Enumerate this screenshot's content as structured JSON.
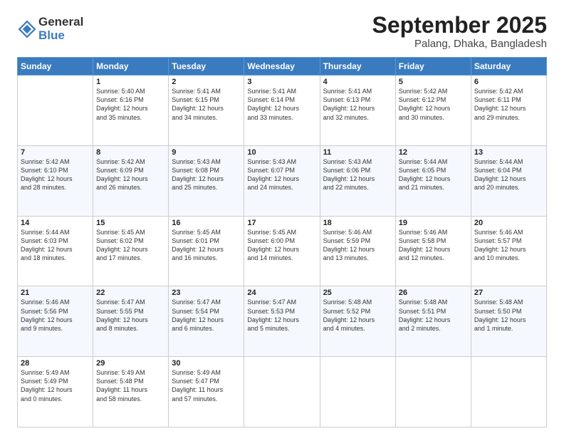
{
  "logo": {
    "general": "General",
    "blue": "Blue"
  },
  "title": {
    "month": "September 2025",
    "location": "Palang, Dhaka, Bangladesh"
  },
  "headers": [
    "Sunday",
    "Monday",
    "Tuesday",
    "Wednesday",
    "Thursday",
    "Friday",
    "Saturday"
  ],
  "weeks": [
    [
      {
        "day": "",
        "info": ""
      },
      {
        "day": "1",
        "info": "Sunrise: 5:40 AM\nSunset: 6:16 PM\nDaylight: 12 hours\nand 35 minutes."
      },
      {
        "day": "2",
        "info": "Sunrise: 5:41 AM\nSunset: 6:15 PM\nDaylight: 12 hours\nand 34 minutes."
      },
      {
        "day": "3",
        "info": "Sunrise: 5:41 AM\nSunset: 6:14 PM\nDaylight: 12 hours\nand 33 minutes."
      },
      {
        "day": "4",
        "info": "Sunrise: 5:41 AM\nSunset: 6:13 PM\nDaylight: 12 hours\nand 32 minutes."
      },
      {
        "day": "5",
        "info": "Sunrise: 5:42 AM\nSunset: 6:12 PM\nDaylight: 12 hours\nand 30 minutes."
      },
      {
        "day": "6",
        "info": "Sunrise: 5:42 AM\nSunset: 6:11 PM\nDaylight: 12 hours\nand 29 minutes."
      }
    ],
    [
      {
        "day": "7",
        "info": "Sunrise: 5:42 AM\nSunset: 6:10 PM\nDaylight: 12 hours\nand 28 minutes."
      },
      {
        "day": "8",
        "info": "Sunrise: 5:42 AM\nSunset: 6:09 PM\nDaylight: 12 hours\nand 26 minutes."
      },
      {
        "day": "9",
        "info": "Sunrise: 5:43 AM\nSunset: 6:08 PM\nDaylight: 12 hours\nand 25 minutes."
      },
      {
        "day": "10",
        "info": "Sunrise: 5:43 AM\nSunset: 6:07 PM\nDaylight: 12 hours\nand 24 minutes."
      },
      {
        "day": "11",
        "info": "Sunrise: 5:43 AM\nSunset: 6:06 PM\nDaylight: 12 hours\nand 22 minutes."
      },
      {
        "day": "12",
        "info": "Sunrise: 5:44 AM\nSunset: 6:05 PM\nDaylight: 12 hours\nand 21 minutes."
      },
      {
        "day": "13",
        "info": "Sunrise: 5:44 AM\nSunset: 6:04 PM\nDaylight: 12 hours\nand 20 minutes."
      }
    ],
    [
      {
        "day": "14",
        "info": "Sunrise: 5:44 AM\nSunset: 6:03 PM\nDaylight: 12 hours\nand 18 minutes."
      },
      {
        "day": "15",
        "info": "Sunrise: 5:45 AM\nSunset: 6:02 PM\nDaylight: 12 hours\nand 17 minutes."
      },
      {
        "day": "16",
        "info": "Sunrise: 5:45 AM\nSunset: 6:01 PM\nDaylight: 12 hours\nand 16 minutes."
      },
      {
        "day": "17",
        "info": "Sunrise: 5:45 AM\nSunset: 6:00 PM\nDaylight: 12 hours\nand 14 minutes."
      },
      {
        "day": "18",
        "info": "Sunrise: 5:46 AM\nSunset: 5:59 PM\nDaylight: 12 hours\nand 13 minutes."
      },
      {
        "day": "19",
        "info": "Sunrise: 5:46 AM\nSunset: 5:58 PM\nDaylight: 12 hours\nand 12 minutes."
      },
      {
        "day": "20",
        "info": "Sunrise: 5:46 AM\nSunset: 5:57 PM\nDaylight: 12 hours\nand 10 minutes."
      }
    ],
    [
      {
        "day": "21",
        "info": "Sunrise: 5:46 AM\nSunset: 5:56 PM\nDaylight: 12 hours\nand 9 minutes."
      },
      {
        "day": "22",
        "info": "Sunrise: 5:47 AM\nSunset: 5:55 PM\nDaylight: 12 hours\nand 8 minutes."
      },
      {
        "day": "23",
        "info": "Sunrise: 5:47 AM\nSunset: 5:54 PM\nDaylight: 12 hours\nand 6 minutes."
      },
      {
        "day": "24",
        "info": "Sunrise: 5:47 AM\nSunset: 5:53 PM\nDaylight: 12 hours\nand 5 minutes."
      },
      {
        "day": "25",
        "info": "Sunrise: 5:48 AM\nSunset: 5:52 PM\nDaylight: 12 hours\nand 4 minutes."
      },
      {
        "day": "26",
        "info": "Sunrise: 5:48 AM\nSunset: 5:51 PM\nDaylight: 12 hours\nand 2 minutes."
      },
      {
        "day": "27",
        "info": "Sunrise: 5:48 AM\nSunset: 5:50 PM\nDaylight: 12 hours\nand 1 minute."
      }
    ],
    [
      {
        "day": "28",
        "info": "Sunrise: 5:49 AM\nSunset: 5:49 PM\nDaylight: 12 hours\nand 0 minutes."
      },
      {
        "day": "29",
        "info": "Sunrise: 5:49 AM\nSunset: 5:48 PM\nDaylight: 11 hours\nand 58 minutes."
      },
      {
        "day": "30",
        "info": "Sunrise: 5:49 AM\nSunset: 5:47 PM\nDaylight: 11 hours\nand 57 minutes."
      },
      {
        "day": "",
        "info": ""
      },
      {
        "day": "",
        "info": ""
      },
      {
        "day": "",
        "info": ""
      },
      {
        "day": "",
        "info": ""
      }
    ]
  ]
}
